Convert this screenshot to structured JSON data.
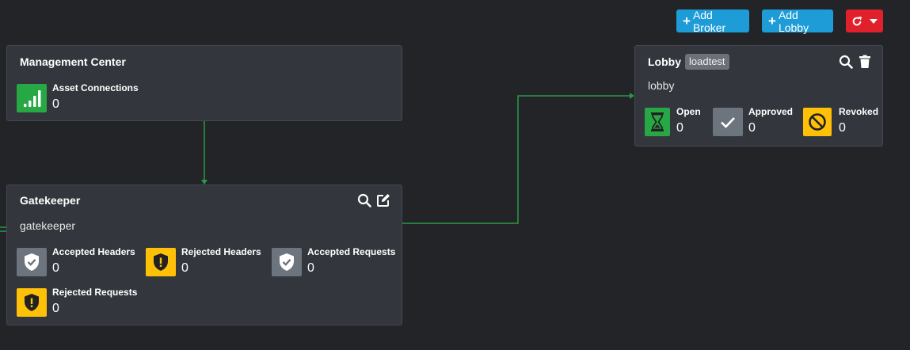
{
  "toolbar": {
    "add_broker_label": "Add Broker",
    "add_lobby_label": "Add Lobby"
  },
  "colors": {
    "background": "#222428",
    "card": "#33363c",
    "primary": "#1e9cd7",
    "danger": "#e0202a",
    "success": "#28a745",
    "warning": "#ffc107",
    "secondary": "#6c757d",
    "connector": "#2a9a47"
  },
  "management_center": {
    "title": "Management Center",
    "stats": [
      {
        "label": "Asset Connections",
        "value": "0",
        "icon": "signal-bars-icon"
      }
    ]
  },
  "gatekeeper": {
    "title": "Gatekeeper",
    "subtitle": "gatekeeper",
    "stats": [
      {
        "label": "Accepted Headers",
        "value": "0",
        "icon": "shield-check-icon"
      },
      {
        "label": "Rejected Headers",
        "value": "0",
        "icon": "shield-alert-icon"
      },
      {
        "label": "Accepted Requests",
        "value": "0",
        "icon": "shield-check-icon"
      },
      {
        "label": "Rejected Requests",
        "value": "0",
        "icon": "shield-alert-icon"
      }
    ]
  },
  "lobby": {
    "title": "Lobby",
    "badge": "loadtest",
    "subtitle": "lobby",
    "stats": [
      {
        "label": "Open",
        "value": "0",
        "icon": "hourglass-icon"
      },
      {
        "label": "Approved",
        "value": "0",
        "icon": "check-icon"
      },
      {
        "label": "Revoked",
        "value": "0",
        "icon": "ban-icon"
      }
    ]
  }
}
